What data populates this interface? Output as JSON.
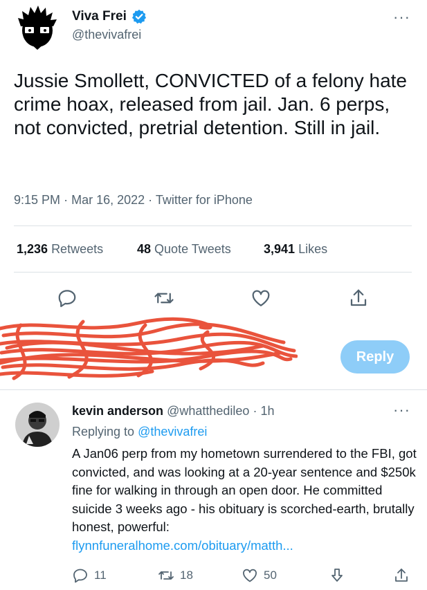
{
  "tweet": {
    "author_name": "Viva Frei",
    "author_handle": "@thevivafrei",
    "text": "Jussie Smollett, CONVICTED of a felony hate crime hoax, released from jail. Jan. 6 perps, not convicted, pretrial detention. Still in jail.",
    "time": "9:15 PM",
    "date": "Mar 16, 2022",
    "source": "Twitter for iPhone",
    "meta_sep": "·",
    "retweets_count": "1,236",
    "retweets_label": "Retweets",
    "quotes_count": "48",
    "quotes_label": "Quote Tweets",
    "likes_count": "3,941",
    "likes_label": "Likes",
    "more": "···"
  },
  "composer": {
    "reply_label": "Reply"
  },
  "reply": {
    "author_name": "kevin anderson",
    "author_handle": "@whatthedileo",
    "sep": "·",
    "time_ago": "1h",
    "replying_prefix": "Replying to",
    "replying_to": "@thevivafrei",
    "text": "A Jan06 perp from my hometown surrendered to the FBI, got convicted, and was looking at a 20-year sentence and $250k fine for walking in through an open door.  He committed suicide 3 weeks ago - his obituary is scorched-earth, brutally honest, powerful:",
    "link": "flynnfuneralhome.com/obituary/matth...",
    "reply_count": "11",
    "retweet_count": "18",
    "like_count": "50",
    "more": "···"
  },
  "colors": {
    "accent": "#1d9bf0",
    "reply_button": "#8ecdf8",
    "secondary_text": "#536471",
    "scribble": "#e8452c"
  },
  "icons": [
    "verified-badge-icon",
    "more-icon",
    "reply-icon",
    "retweet-icon",
    "like-icon",
    "share-icon",
    "downvote-icon"
  ]
}
